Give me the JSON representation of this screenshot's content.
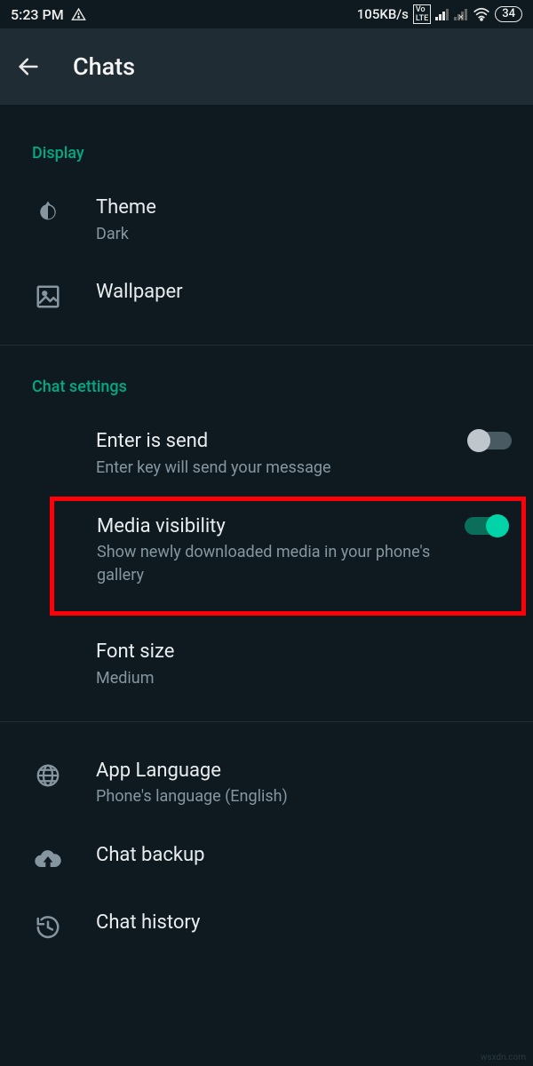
{
  "statusbar": {
    "time": "5:23 PM",
    "net_speed": "105KB/s",
    "battery": "34"
  },
  "appbar": {
    "title": "Chats"
  },
  "sections": {
    "display": {
      "header": "Display",
      "theme": {
        "title": "Theme",
        "sub": "Dark"
      },
      "wallpaper": {
        "title": "Wallpaper"
      }
    },
    "chat_settings": {
      "header": "Chat settings",
      "enter_send": {
        "title": "Enter is send",
        "sub": "Enter key will send your message",
        "on": false
      },
      "media_vis": {
        "title": "Media visibility",
        "sub": "Show newly downloaded media in your phone's gallery",
        "on": true
      },
      "font_size": {
        "title": "Font size",
        "sub": "Medium"
      },
      "app_lang": {
        "title": "App Language",
        "sub": "Phone's language (English)"
      },
      "backup": {
        "title": "Chat backup"
      },
      "history": {
        "title": "Chat history"
      }
    }
  },
  "watermark": "wsxdn.com"
}
